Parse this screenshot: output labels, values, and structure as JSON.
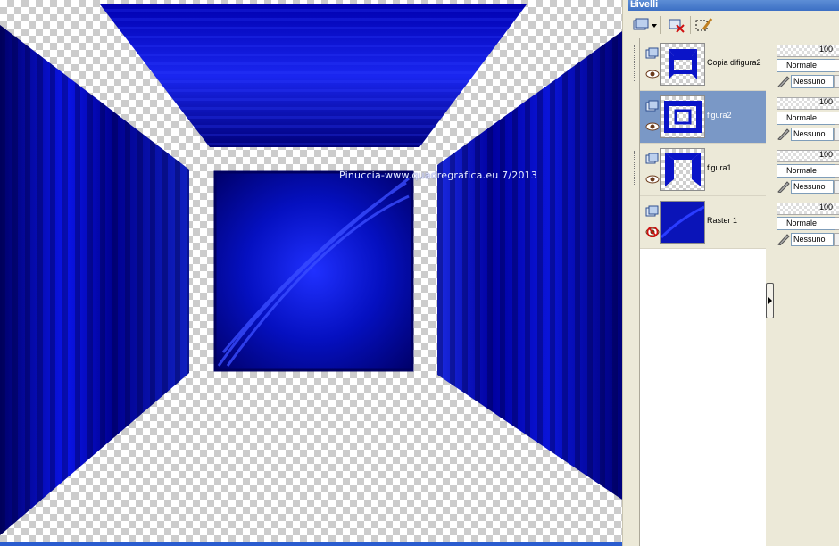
{
  "canvas": {
    "watermark_text": "Pinuccia-www.quadregrafica.eu 7/2013",
    "accent_blue": "#0b12c8"
  },
  "panel": {
    "title": "Livelli",
    "toolbar": {
      "new_layer_icon": "new-layer-icon",
      "delete_layer_icon": "delete-layer-icon",
      "edit_selection_icon": "edit-selection-icon"
    },
    "layers": [
      {
        "name": "Copia difigura2",
        "visible": true,
        "selected": false,
        "opacity": "100",
        "blend": "Normale",
        "mask": "Nessuno"
      },
      {
        "name": "figura2",
        "visible": true,
        "selected": true,
        "opacity": "100",
        "blend": "Normale",
        "mask": "Nessuno"
      },
      {
        "name": "figura1",
        "visible": true,
        "selected": false,
        "opacity": "100",
        "blend": "Normale",
        "mask": "Nessuno"
      },
      {
        "name": "Raster 1",
        "visible": false,
        "selected": false,
        "opacity": "100",
        "blend": "Normale",
        "mask": "Nessuno"
      }
    ],
    "selected_color": "#7a98c6"
  }
}
